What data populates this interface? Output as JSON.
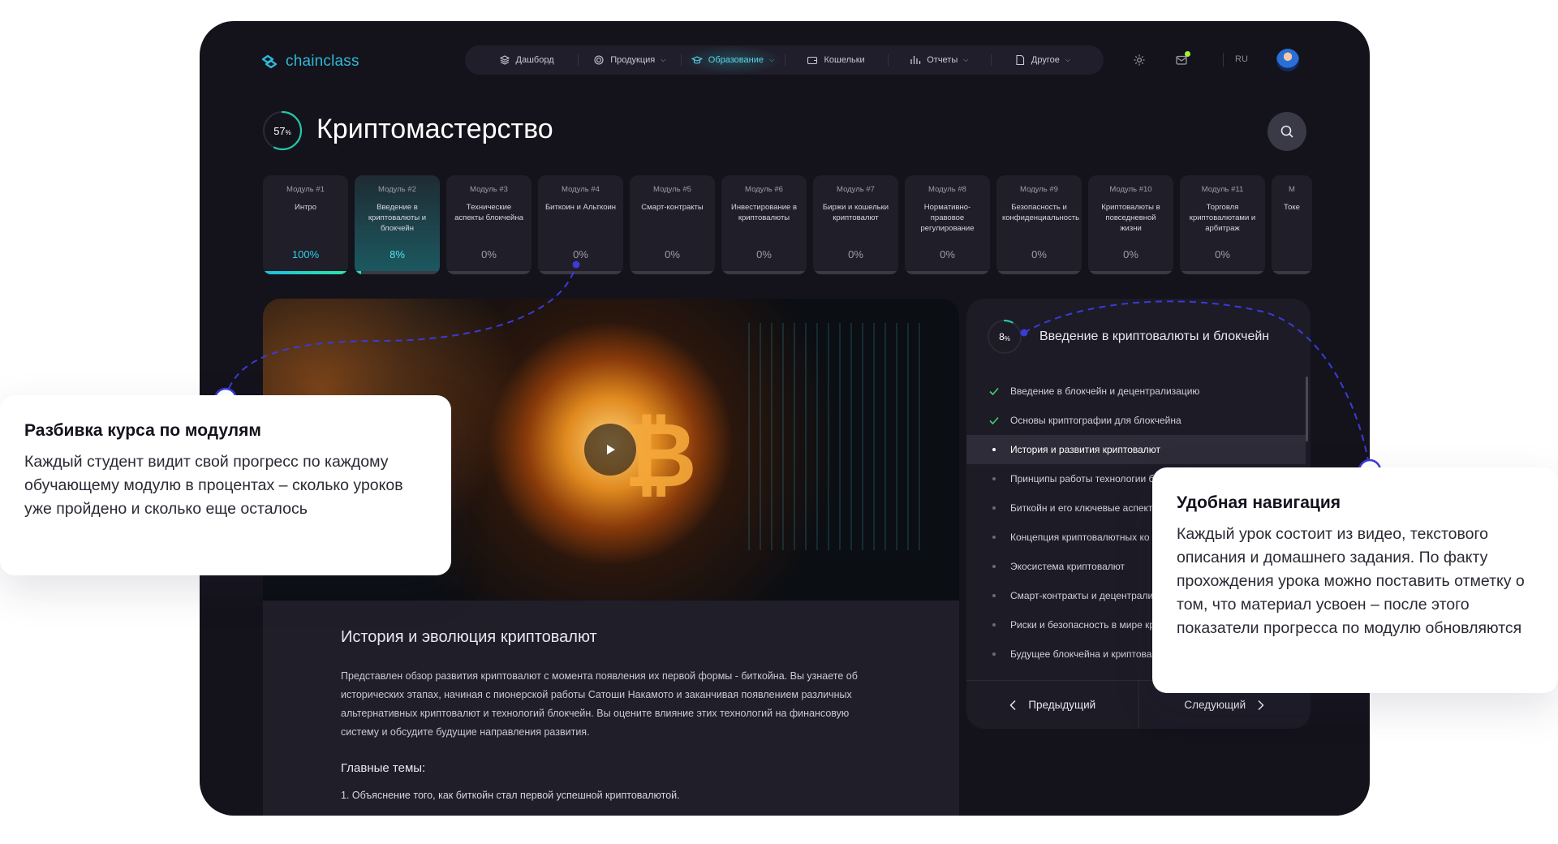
{
  "app": {
    "logo_text": "chainclass"
  },
  "nav": [
    {
      "label": "Дашборд",
      "icon": "layers-icon",
      "dropdown": false,
      "active": false
    },
    {
      "label": "Продукция",
      "icon": "coin-icon",
      "dropdown": true,
      "active": false
    },
    {
      "label": "Образование",
      "icon": "graduation-cap-icon",
      "dropdown": true,
      "active": true
    },
    {
      "label": "Кошельки",
      "icon": "wallet-icon",
      "dropdown": false,
      "active": false
    },
    {
      "label": "Отчеты",
      "icon": "bar-chart-icon",
      "dropdown": true,
      "active": false
    },
    {
      "label": "Другое",
      "icon": "document-icon",
      "dropdown": true,
      "active": false
    }
  ],
  "header": {
    "language": "RU",
    "settings_icon": "gear-icon",
    "mail_icon": "mail-icon"
  },
  "course": {
    "title": "Криптомастерство",
    "progress_value": "57",
    "progress_unit": "%"
  },
  "modules": [
    {
      "num": "Модуль #1",
      "title": "Интро",
      "pct": "100%"
    },
    {
      "num": "Модуль #2",
      "title": "Введение в криптовалюты и блокчейн",
      "pct": "8%"
    },
    {
      "num": "Модуль #3",
      "title": "Технические аспекты блокчейна",
      "pct": "0%"
    },
    {
      "num": "Модуль #4",
      "title": "Биткоин и Альткоин",
      "pct": "0%"
    },
    {
      "num": "Модуль #5",
      "title": "Смарт-контракты",
      "pct": "0%"
    },
    {
      "num": "Модуль #6",
      "title": "Инвестирование в криптовалюты",
      "pct": "0%"
    },
    {
      "num": "Модуль #7",
      "title": "Биржи и кошельки криптовалют",
      "pct": "0%"
    },
    {
      "num": "Модуль #8",
      "title": "Нормативно-правовое регулирование",
      "pct": "0%"
    },
    {
      "num": "Модуль #9",
      "title": "Безопасность и конфиденциальность",
      "pct": "0%"
    },
    {
      "num": "Модуль #10",
      "title": "Криптовалюты в повседневной жизни",
      "pct": "0%"
    },
    {
      "num": "Модуль #11",
      "title": "Торговля криптовалютами и арбитраж",
      "pct": "0%"
    },
    {
      "num": "М",
      "title": "Токе",
      "pct": ""
    }
  ],
  "lesson": {
    "title": "История и эволюция криптовалют",
    "description": "Представлен обзор развития криптовалют с момента появления их первой формы - биткойна. Вы узнаете об исторических этапах, начиная с пионерской работы Сатоши Накамото и заканчивая появлением различных альтернативных криптовалют и технологий блокчейн. Вы оцените влияние этих технологий на финансовую систему и обсудите будущие направления развития.",
    "topics_heading": "Главные темы:",
    "topics": [
      "1. Объяснение того, как биткойн стал первой успешной криптовалютой."
    ]
  },
  "panel": {
    "progress_value": "8",
    "progress_unit": "%",
    "title": "Введение в криптовалюты и блокчейн",
    "lessons": [
      {
        "label": "Введение в блокчейн и децентрализацию",
        "state": "done"
      },
      {
        "label": "Основы криптографии для блокчейна",
        "state": "done"
      },
      {
        "label": "История и развития криптовалют",
        "state": "current"
      },
      {
        "label": "Принципы работы технологии б",
        "state": "todo"
      },
      {
        "label": "Биткойн и его ключевые аспект",
        "state": "todo"
      },
      {
        "label": "Концепция криптовалютных ко",
        "state": "todo"
      },
      {
        "label": "Экосистема криптовалют",
        "state": "todo"
      },
      {
        "label": "Смарт-контракты и децентрали",
        "state": "todo"
      },
      {
        "label": "Риски и безопасность в мире кр",
        "state": "todo"
      },
      {
        "label": "Будущее блокчейна и криптова",
        "state": "todo"
      }
    ],
    "prev_label": "Предыдущий",
    "next_label": "Следующий"
  },
  "callouts": {
    "modules": {
      "title": "Разбивка курса по модулям",
      "text": "Каждый студент видит свой прогресс по каждому обучающему модулю в процентах – сколько уроков уже пройдено и сколько еще осталось"
    },
    "navigation": {
      "title": "Удобная навигация",
      "text": "Каждый урок состоит из видео, текстового описания и домашнего задания. По факту прохождения урока можно поставить отметку о том, что материал усвоен – после этого показатели прогресса по модулю обновляются"
    }
  },
  "colors": {
    "accent": "#2fb8d6",
    "frame_bg": "#14131c",
    "callout_line": "#3b3bd8"
  }
}
